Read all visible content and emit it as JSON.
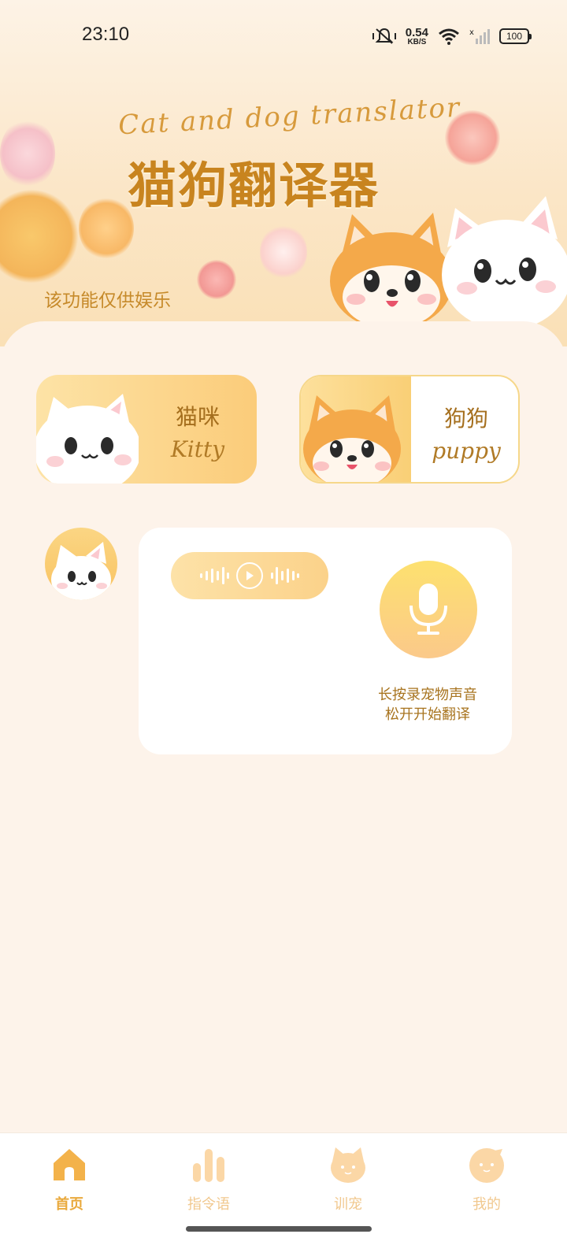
{
  "status_bar": {
    "time": "23:10",
    "net_speed_value": "0.54",
    "net_speed_unit": "KB/S",
    "battery": "100"
  },
  "header": {
    "subtitle": "Cat and dog translator",
    "title": "猫狗翻译器",
    "note": "该功能仅供娱乐"
  },
  "modes": {
    "cat": {
      "name": "猫咪",
      "en": "Kitty"
    },
    "dog": {
      "name": "狗狗",
      "en": "puppy"
    }
  },
  "recorder": {
    "hint_line1": "长按录宠物声音",
    "hint_line2": "松开开始翻译"
  },
  "tabs": [
    {
      "label": "首页",
      "icon": "home-icon"
    },
    {
      "label": "指令语",
      "icon": "bars-icon"
    },
    {
      "label": "训宠",
      "icon": "cat-face-icon"
    },
    {
      "label": "我的",
      "icon": "profile-icon"
    }
  ],
  "colors": {
    "accent": "#e9a93c",
    "title": "#c8841f",
    "background": "#fdf3ea"
  }
}
